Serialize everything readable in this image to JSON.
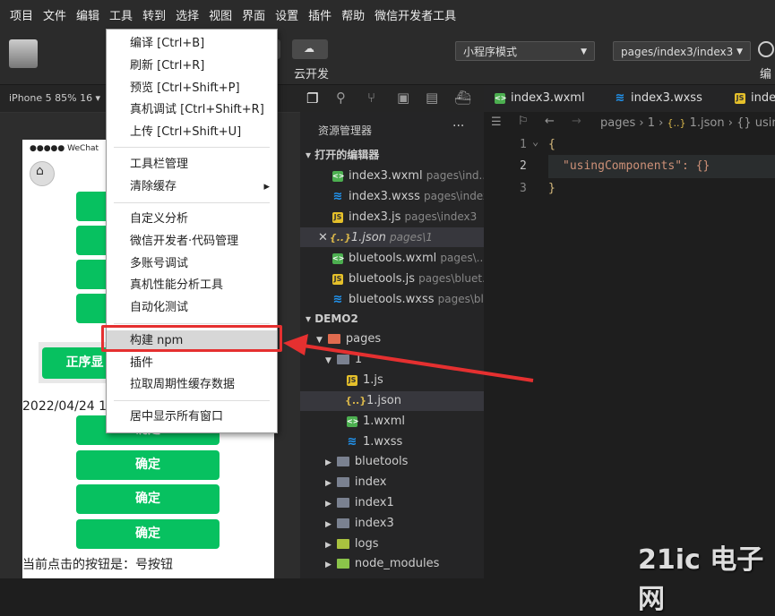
{
  "menubar": [
    "项目",
    "文件",
    "编辑",
    "工具",
    "转到",
    "选择",
    "视图",
    "界面",
    "设置",
    "插件",
    "帮助",
    "微信开发者工具"
  ],
  "toolbar": {
    "cloud_label": "云开发",
    "mode_select": "小程序模式",
    "page_select": "pages/index3/index3",
    "compile_label": "编"
  },
  "simulator": {
    "device": "iPhone 5 85% 16 ▾",
    "status_bar": "●●●●● WeChat",
    "partial_button": "正序显",
    "date_text": "2022/04/24 15",
    "confirm_label": "确定",
    "footer_text": "当前点击的按钮是：号按钮"
  },
  "explorer": {
    "title": "资源管理器",
    "more": "···",
    "open_editors": "打开的编辑器",
    "open_files": [
      {
        "name": "index3.wxml",
        "path": "pages\\ind...",
        "type": "wx"
      },
      {
        "name": "index3.wxss",
        "path": "pages\\index3",
        "type": "css"
      },
      {
        "name": "index3.js",
        "path": "pages\\index3",
        "type": "js"
      },
      {
        "name": "1.json",
        "path": "pages\\1",
        "type": "json"
      },
      {
        "name": "bluetools.wxml",
        "path": "pages\\...",
        "type": "wx"
      },
      {
        "name": "bluetools.js",
        "path": "pages\\bluet...",
        "type": "js"
      },
      {
        "name": "bluetools.wxss",
        "path": "pages\\bl...",
        "type": "css"
      }
    ],
    "project": "DEMO2",
    "tree": [
      {
        "name": "pages",
        "type": "folder"
      },
      {
        "name": "1",
        "type": "folder"
      },
      {
        "name": "1.js",
        "type": "js"
      },
      {
        "name": "1.json",
        "type": "json"
      },
      {
        "name": "1.wxml",
        "type": "wx"
      },
      {
        "name": "1.wxss",
        "type": "css"
      },
      {
        "name": "bluetools",
        "type": "folder"
      },
      {
        "name": "index",
        "type": "folder"
      },
      {
        "name": "index1",
        "type": "folder"
      },
      {
        "name": "index3",
        "type": "folder"
      },
      {
        "name": "logs",
        "type": "folder"
      },
      {
        "name": "node_modules",
        "type": "folder"
      }
    ]
  },
  "editor": {
    "tabs": [
      "index3.wxml",
      "index3.wxss",
      "inde"
    ],
    "breadcrumb": [
      "pages",
      "1",
      "1.json",
      "{}",
      "usin"
    ],
    "lines": [
      "1",
      "2",
      "3"
    ],
    "code": [
      "{",
      "\"usingComponents\": {}",
      "}"
    ]
  },
  "dropdown": {
    "items": [
      "编译  [Ctrl+B]",
      "刷新  [Ctrl+R]",
      "预览  [Ctrl+Shift+P]",
      "真机调试  [Ctrl+Shift+R]",
      "上传  [Ctrl+Shift+U]",
      "工具栏管理",
      "清除缓存",
      "自定义分析",
      "微信开发者·代码管理",
      "多账号调试",
      "真机性能分析工具",
      "自动化测试",
      "构建 npm",
      "插件",
      "拉取周期性缓存数据",
      "居中显示所有窗口"
    ],
    "submenu_arrow": "▸"
  },
  "watermark": "21ic 电子网",
  "colors": {
    "accent": "#07c160",
    "highlight": "#e53030",
    "menu_hover": "#d7d7d7"
  }
}
